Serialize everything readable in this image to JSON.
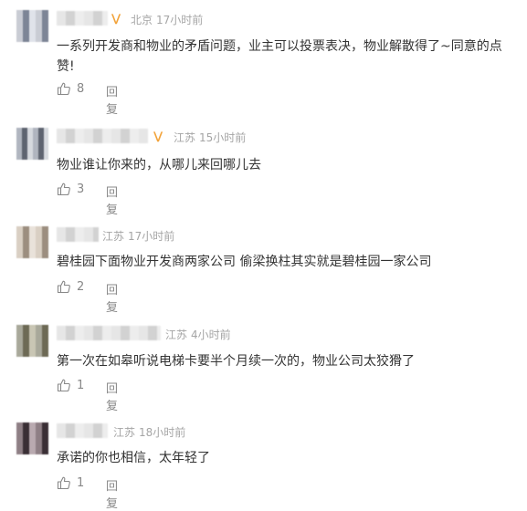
{
  "comments": [
    {
      "location": "北京",
      "time": "17小时前",
      "vip": true,
      "text": "一系列开发商和物业的矛盾问题，业主可以投票表决，物业解散得了~同意的点赞!",
      "likes": "8",
      "reply": "回复"
    },
    {
      "location": "江苏",
      "time": "15小时前",
      "vip": true,
      "text": "物业谁让你来的，从哪儿来回哪儿去",
      "likes": "3",
      "reply": "回复"
    },
    {
      "location": "江苏",
      "time": "17小时前",
      "vip": false,
      "text": "碧桂园下面物业开发商两家公司 偷梁换柱其实就是碧桂园一家公司",
      "likes": "2",
      "reply": "回复"
    },
    {
      "location": "江苏",
      "time": "4小时前",
      "vip": false,
      "text": "第一次在如皋听说电梯卡要半个月续一次的，物业公司太狡猾了",
      "likes": "1",
      "reply": "回复"
    },
    {
      "location": "江苏",
      "time": "18小时前",
      "vip": false,
      "text": "承诺的你也相信，太年轻了",
      "likes": "1",
      "reply": "回复"
    }
  ],
  "icons": {
    "vip": "vip-badge-icon",
    "like": "thumbs-up-icon"
  },
  "colors": {
    "vip": "#f2a33a",
    "meta": "#a5a5a5",
    "text": "#333333",
    "action": "#888888"
  }
}
